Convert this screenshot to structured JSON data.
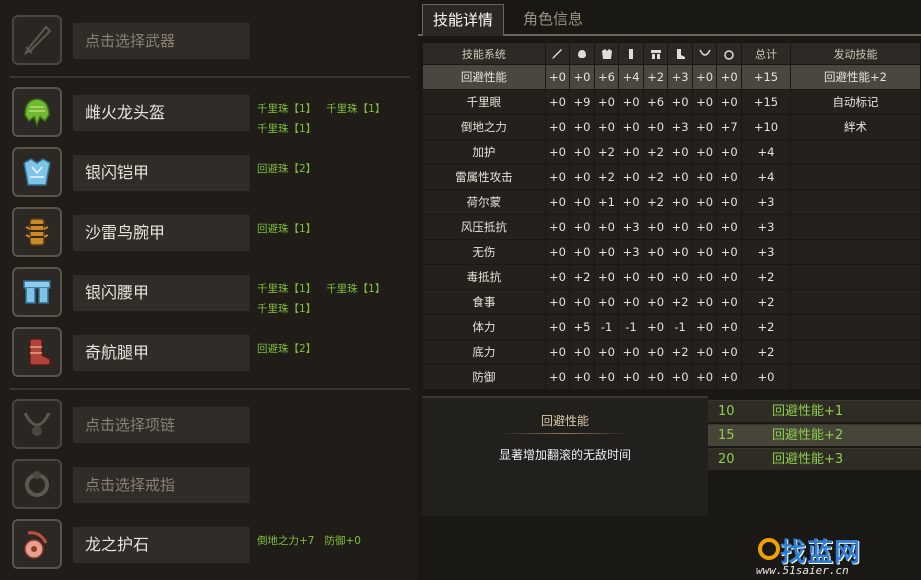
{
  "equipment": {
    "weapon": {
      "name": "点击选择武器",
      "icon": "weapon-slot-icon"
    },
    "head": {
      "name": "雌火龙头盔",
      "icon": "helmet-icon",
      "decos": [
        "千里珠【1】",
        "千里珠【1】",
        "千里珠【1】"
      ]
    },
    "chest": {
      "name": "银闪铠甲",
      "icon": "chest-armor-icon",
      "decos": [
        "回避珠【2】"
      ]
    },
    "arms": {
      "name": "沙雷鸟腕甲",
      "icon": "arm-armor-icon",
      "decos": [
        "回避珠【1】"
      ]
    },
    "waist": {
      "name": "银闪腰甲",
      "icon": "waist-armor-icon",
      "decos": [
        "千里珠【1】",
        "千里珠【1】",
        "千里珠【1】"
      ]
    },
    "legs": {
      "name": "奇航腿甲",
      "icon": "leg-armor-icon",
      "decos": [
        "回避珠【2】"
      ]
    },
    "necklace": {
      "name": "点击选择项链",
      "icon": "necklace-slot-icon"
    },
    "ring": {
      "name": "点击选择戒指",
      "icon": "ring-slot-icon"
    },
    "charm": {
      "name": "龙之护石",
      "icon": "charm-icon",
      "decos": [
        "倒地之力+7",
        "防御+0"
      ]
    }
  },
  "tabs": {
    "skills": "技能详情",
    "character": "角色信息"
  },
  "table": {
    "header_skill": "技能系统",
    "header_total": "总计",
    "header_activated": "发动技能",
    "column_icons": [
      "weapon-icon",
      "helmet-icon",
      "chest-icon",
      "arm-icon",
      "waist-icon",
      "leg-icon",
      "necklace-icon",
      "ring-icon"
    ],
    "rows": [
      {
        "name": "回避性能",
        "vals": [
          "+0",
          "+0",
          "+6",
          "+4",
          "+2",
          "+3",
          "+0",
          "+0"
        ],
        "total": "+15",
        "act": "回避性能+2"
      },
      {
        "name": "千里眼",
        "vals": [
          "+0",
          "+9",
          "+0",
          "+0",
          "+6",
          "+0",
          "+0",
          "+0"
        ],
        "total": "+15",
        "act": "自动标记"
      },
      {
        "name": "倒地之力",
        "vals": [
          "+0",
          "+0",
          "+0",
          "+0",
          "+0",
          "+3",
          "+0",
          "+7"
        ],
        "total": "+10",
        "act": "絆术"
      },
      {
        "name": "加护",
        "vals": [
          "+0",
          "+0",
          "+2",
          "+0",
          "+2",
          "+0",
          "+0",
          "+0"
        ],
        "total": "+4",
        "act": ""
      },
      {
        "name": "雷属性攻击",
        "vals": [
          "+0",
          "+0",
          "+2",
          "+0",
          "+2",
          "+0",
          "+0",
          "+0"
        ],
        "total": "+4",
        "act": ""
      },
      {
        "name": "荷尔蒙",
        "vals": [
          "+0",
          "+0",
          "+1",
          "+0",
          "+2",
          "+0",
          "+0",
          "+0"
        ],
        "total": "+3",
        "act": ""
      },
      {
        "name": "风压抵抗",
        "vals": [
          "+0",
          "+0",
          "+0",
          "+3",
          "+0",
          "+0",
          "+0",
          "+0"
        ],
        "total": "+3",
        "act": ""
      },
      {
        "name": "无伤",
        "vals": [
          "+0",
          "+0",
          "+0",
          "+3",
          "+0",
          "+0",
          "+0",
          "+0"
        ],
        "total": "+3",
        "act": ""
      },
      {
        "name": "毒抵抗",
        "vals": [
          "+0",
          "+2",
          "+0",
          "+0",
          "+0",
          "+0",
          "+0",
          "+0"
        ],
        "total": "+2",
        "act": ""
      },
      {
        "name": "食事",
        "vals": [
          "+0",
          "+0",
          "+0",
          "+0",
          "+0",
          "+2",
          "+0",
          "+0"
        ],
        "total": "+2",
        "act": ""
      },
      {
        "name": "体力",
        "vals": [
          "+0",
          "+5",
          "-1",
          "-1",
          "+0",
          "-1",
          "+0",
          "+0"
        ],
        "total": "+2",
        "act": ""
      },
      {
        "name": "底力",
        "vals": [
          "+0",
          "+0",
          "+0",
          "+0",
          "+0",
          "+2",
          "+0",
          "+0"
        ],
        "total": "+2",
        "act": ""
      },
      {
        "name": "防御",
        "vals": [
          "+0",
          "+0",
          "+0",
          "+0",
          "+0",
          "+0",
          "+0",
          "+0"
        ],
        "total": "+0",
        "act": ""
      }
    ]
  },
  "detail": {
    "title": "回避性能",
    "description": "显著增加翻滚的无敌时间",
    "levels": [
      {
        "points": "10",
        "effect": "回避性能+1"
      },
      {
        "points": "15",
        "effect": "回避性能+2"
      },
      {
        "points": "20",
        "effect": "回避性能+3"
      }
    ]
  },
  "watermark": {
    "brand": "找蓝网",
    "url": "www.51saier.cn"
  }
}
